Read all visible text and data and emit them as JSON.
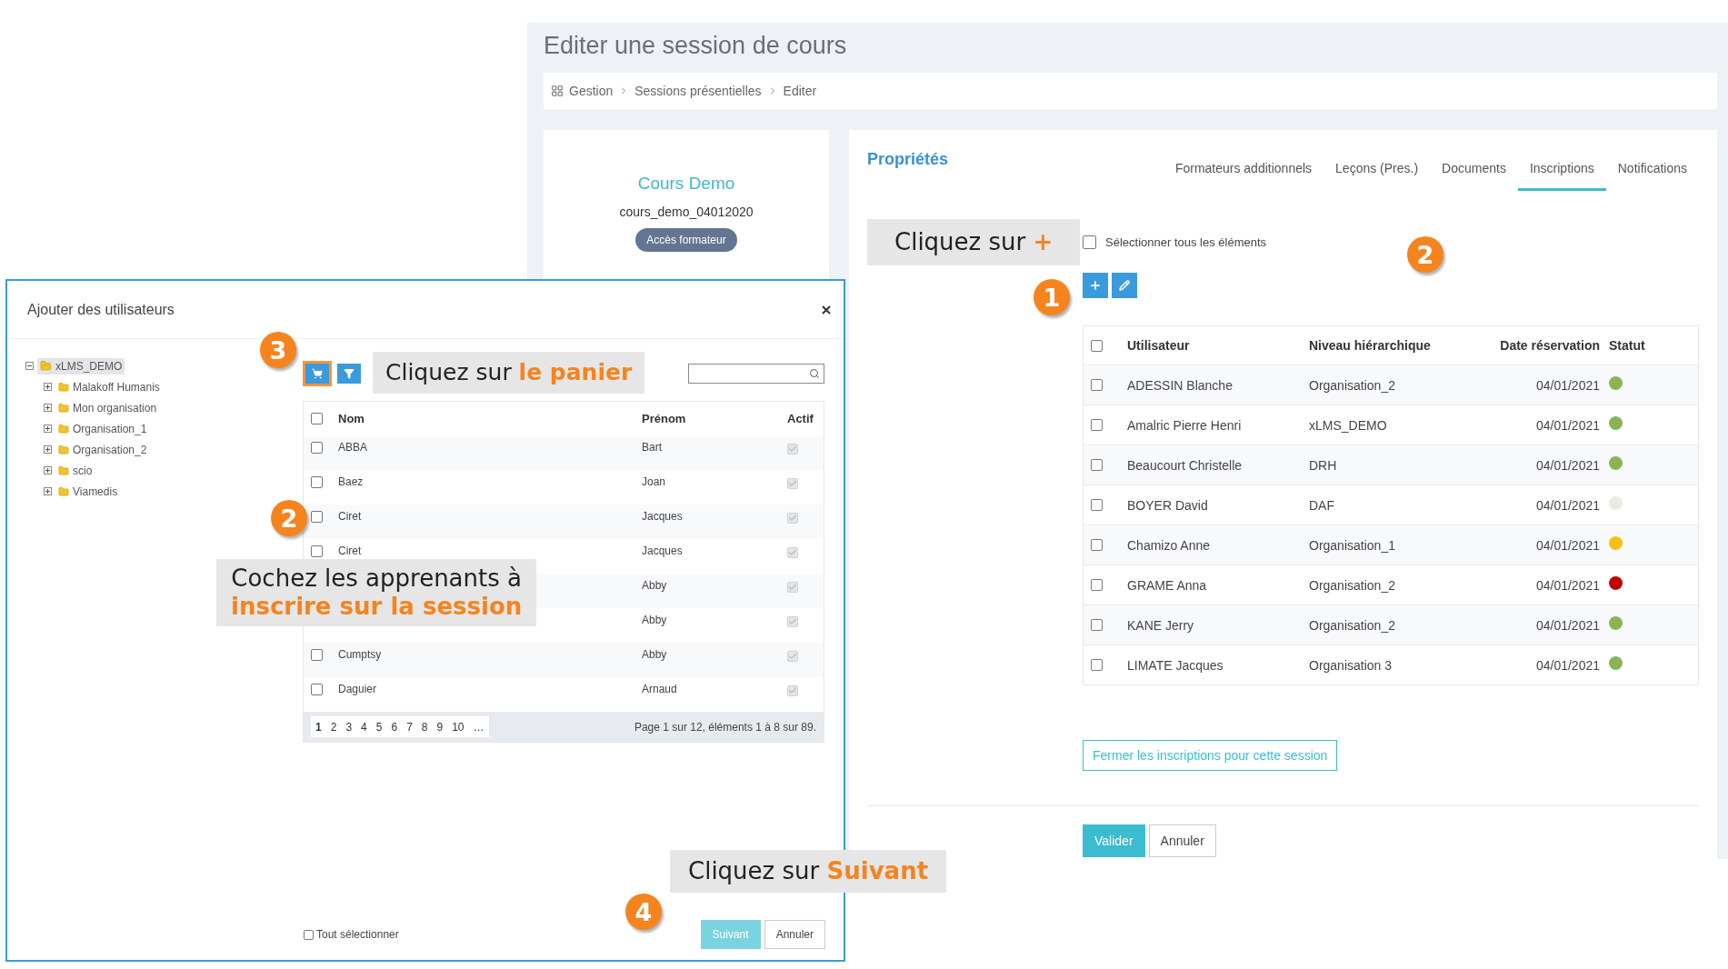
{
  "page": {
    "title": "Editer une session de cours",
    "breadcrumb": [
      "Gestion",
      "Sessions présentielles",
      "Editer"
    ]
  },
  "course_card": {
    "title": "Cours Demo",
    "code": "cours_demo_04012020",
    "button": "Accès formateur"
  },
  "properties": {
    "title": "Propriétés",
    "tabs": [
      {
        "label": "Formateurs additionnels",
        "selected": false
      },
      {
        "label": "Leçons (Pres.)",
        "selected": false
      },
      {
        "label": "Documents",
        "selected": false
      },
      {
        "label": "Inscriptions",
        "selected": true
      },
      {
        "label": "Notifications",
        "selected": false
      }
    ],
    "select_all": {
      "label": "Sélectionner tous les éléments",
      "checked": false
    },
    "actions": [
      {
        "kind": "add"
      },
      {
        "kind": "edit"
      }
    ],
    "table": {
      "columns": [
        "Utilisateur",
        "Niveau hiérarchique",
        "Date réservation",
        "Statut"
      ],
      "header_checked": false,
      "rows": [
        {
          "user": "ADESSIN Blanche",
          "level": "Organisation_2",
          "date": "04/01/2021",
          "color": "#8db255",
          "checked": false
        },
        {
          "user": "Amalric Pierre Henri",
          "level": "xLMS_DEMO",
          "date": "04/01/2021",
          "color": "#8db255",
          "checked": false
        },
        {
          "user": "Beaucourt Christelle",
          "level": "DRH",
          "date": "04/01/2021",
          "color": "#8db255",
          "checked": false
        },
        {
          "user": "BOYER David",
          "level": "DAF",
          "date": "04/01/2021",
          "color": "#ebe9e1",
          "checked": false
        },
        {
          "user": "Chamizo Anne",
          "level": "Organisation_1",
          "date": "04/01/2021",
          "color": "#f6bf12",
          "checked": false
        },
        {
          "user": "GRAME Anna",
          "level": "Organisation_2",
          "date": "04/01/2021",
          "color": "#c00000",
          "checked": false
        },
        {
          "user": "KANE Jerry",
          "level": "Organisation_2",
          "date": "04/01/2021",
          "color": "#8db255",
          "checked": false
        },
        {
          "user": "LIMATE Jacques",
          "level": "Organisation 3",
          "date": "04/01/2021",
          "color": "#8db255",
          "checked": false
        }
      ]
    },
    "close_button": "Fermer les inscriptions pour cette session",
    "buttons": [
      {
        "label": "Valider",
        "kind": "primary"
      },
      {
        "label": "Annuler",
        "kind": "secondary"
      }
    ]
  },
  "modal": {
    "title": "Ajouter des utilisateurs",
    "tree": [
      {
        "label": "xLMS_DEMO",
        "expanded": true,
        "selected": true,
        "children": [
          {
            "label": "Malakoff Humanis",
            "expanded": false,
            "selected": false
          },
          {
            "label": "Mon organisation",
            "expanded": false,
            "selected": false
          },
          {
            "label": "Organisation_1",
            "expanded": false,
            "selected": false
          },
          {
            "label": "Organisation_2",
            "expanded": false,
            "selected": false
          },
          {
            "label": "scio",
            "expanded": false,
            "selected": false
          },
          {
            "label": "Viamedis",
            "expanded": false,
            "selected": false
          }
        ]
      }
    ],
    "toolbar": [
      {
        "kind": "cart",
        "highlighted": true
      },
      {
        "kind": "filter",
        "highlighted": false
      }
    ],
    "table": {
      "columns": [
        "Nom",
        "Prénom",
        "Actif"
      ],
      "header_checked": false,
      "rows": [
        {
          "nom": "ABBA",
          "prenom": "Bart",
          "checked": false,
          "actif": true
        },
        {
          "nom": "Baez",
          "prenom": "Joan",
          "checked": false,
          "actif": true
        },
        {
          "nom": "Ciret",
          "prenom": "Jacques",
          "checked": false,
          "actif": true
        },
        {
          "nom": "Ciret",
          "prenom": "Jacques",
          "checked": false,
          "actif": true
        },
        {
          "prenom": "Abby",
          "actif": true
        },
        {
          "prenom": "Abby",
          "actif": true
        },
        {
          "nom": "Cumptsy",
          "prenom": "Abby",
          "checked": false,
          "actif": true
        },
        {
          "nom": "Daguier",
          "prenom": "Arnaud",
          "checked": false,
          "actif": true
        }
      ]
    },
    "pagination": {
      "pages": [
        {
          "label": "1",
          "selected": true
        },
        {
          "label": "2",
          "selected": false
        },
        {
          "label": "3",
          "selected": false
        },
        {
          "label": "4",
          "selected": false
        },
        {
          "label": "5",
          "selected": false
        },
        {
          "label": "6",
          "selected": false
        },
        {
          "label": "7",
          "selected": false
        },
        {
          "label": "8",
          "selected": false
        },
        {
          "label": "9",
          "selected": false
        },
        {
          "label": "10",
          "selected": false
        },
        {
          "label": "…",
          "selected": false
        }
      ],
      "summary": "Page 1 sur 12, éléments 1 à 8 sur 89."
    },
    "select_all": {
      "label": "Tout sélectionner",
      "checked": false
    },
    "buttons": [
      {
        "label": "Suivant",
        "kind": "primary"
      },
      {
        "label": "Annuler",
        "kind": "secondary"
      }
    ]
  },
  "callouts": [
    {
      "text": "Cliquez sur **+**"
    },
    {
      "text": "Cliquez sur **le panier**"
    },
    {
      "text": "Cochez les apprenants à\n**inscrire sur la session**"
    },
    {
      "text": "Cliquez sur **Suivant**"
    }
  ],
  "badges": [
    "1",
    "2",
    "3",
    "2",
    "4"
  ]
}
